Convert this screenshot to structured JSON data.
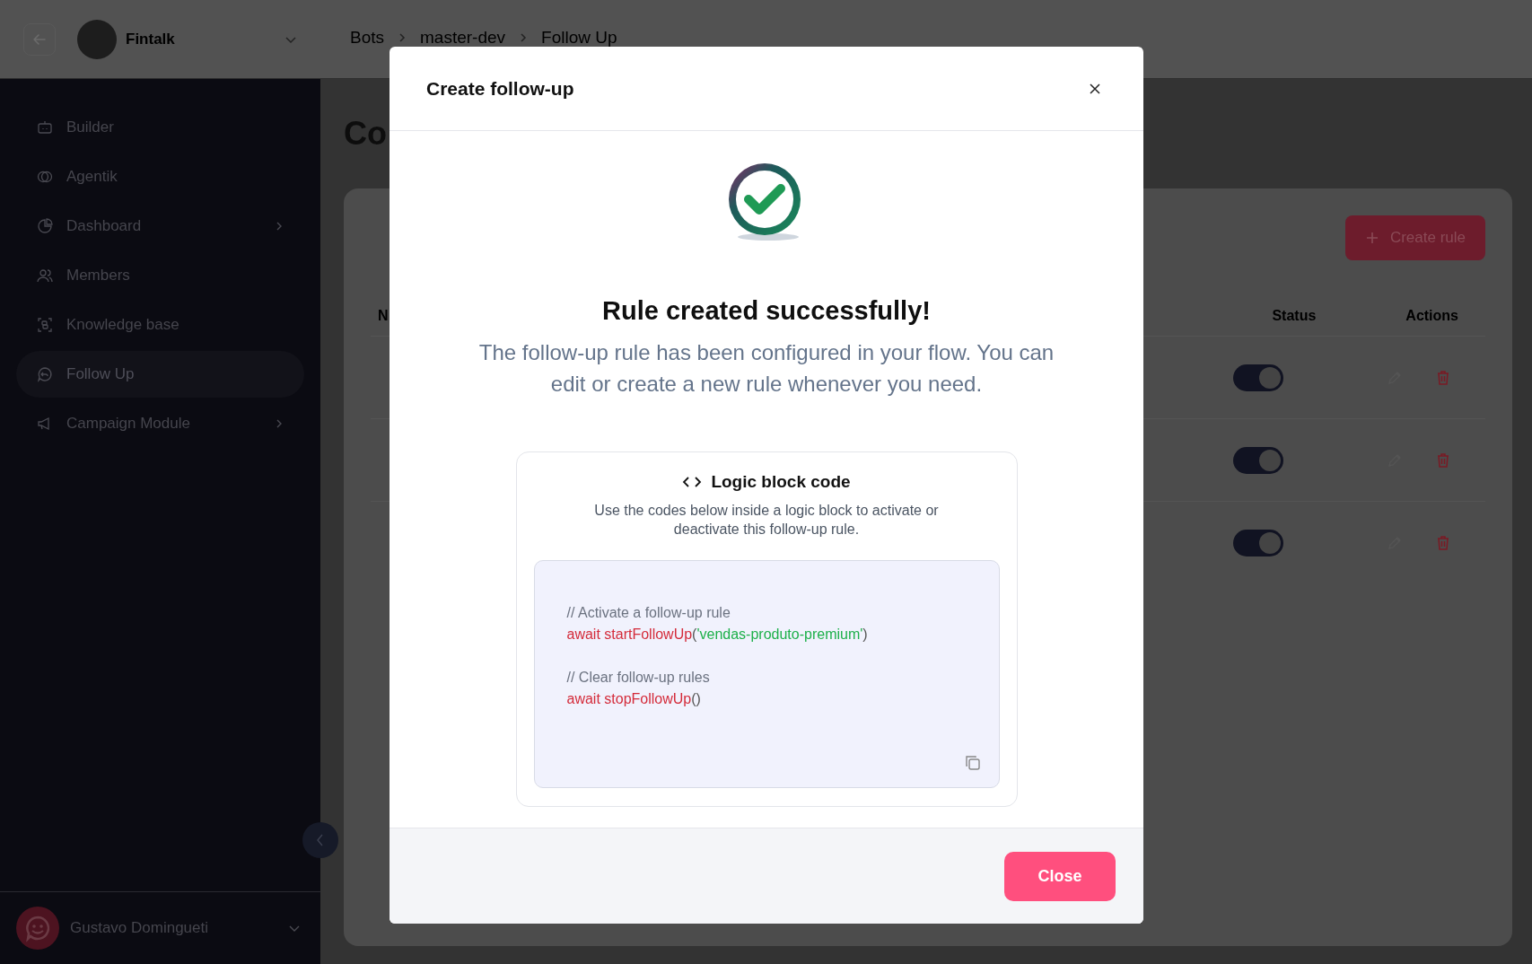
{
  "topbar": {
    "workspace": "Fintalk",
    "breadcrumb": [
      "Bots",
      "master-dev",
      "Follow Up"
    ]
  },
  "sidebar": {
    "items": [
      {
        "label": "Builder",
        "selected": false,
        "has_submenu": false
      },
      {
        "label": "Agentik",
        "selected": false,
        "has_submenu": false
      },
      {
        "label": "Dashboard",
        "selected": false,
        "has_submenu": true
      },
      {
        "label": "Members",
        "selected": false,
        "has_submenu": false
      },
      {
        "label": "Knowledge base",
        "selected": false,
        "has_submenu": false
      },
      {
        "label": "Follow Up",
        "selected": true,
        "has_submenu": false
      },
      {
        "label": "Campaign Module",
        "selected": false,
        "has_submenu": true
      }
    ],
    "user": "Gustavo Domingueti"
  },
  "page": {
    "heading": "Co",
    "create_button": "Create rule",
    "table": {
      "columns": [
        "N",
        "Status",
        "Actions"
      ],
      "rows": [
        {
          "on": true
        },
        {
          "on": true
        },
        {
          "on": true
        }
      ]
    }
  },
  "modal": {
    "title": "Create follow-up",
    "heading": "Rule created successfully!",
    "message": "The follow-up rule has been configured in your flow. You can edit or create a new rule whenever you need.",
    "code_card": {
      "title": "Logic block code",
      "description": "Use the codes below inside a logic block to activate or deactivate this follow-up rule.",
      "blocks": [
        {
          "comment": "// Activate a follow-up rule",
          "segments": [
            {
              "kind": "call",
              "text": "await startFollowUp"
            },
            {
              "kind": "punct",
              "text": "("
            },
            {
              "kind": "string",
              "text": "'vendas-produto-premium'"
            },
            {
              "kind": "punct",
              "text": ")"
            }
          ]
        },
        {
          "comment": "// Clear follow-up rules",
          "segments": [
            {
              "kind": "call",
              "text": "await stopFollowUp"
            },
            {
              "kind": "punct",
              "text": "()"
            }
          ]
        }
      ]
    },
    "close_button": "Close"
  }
}
